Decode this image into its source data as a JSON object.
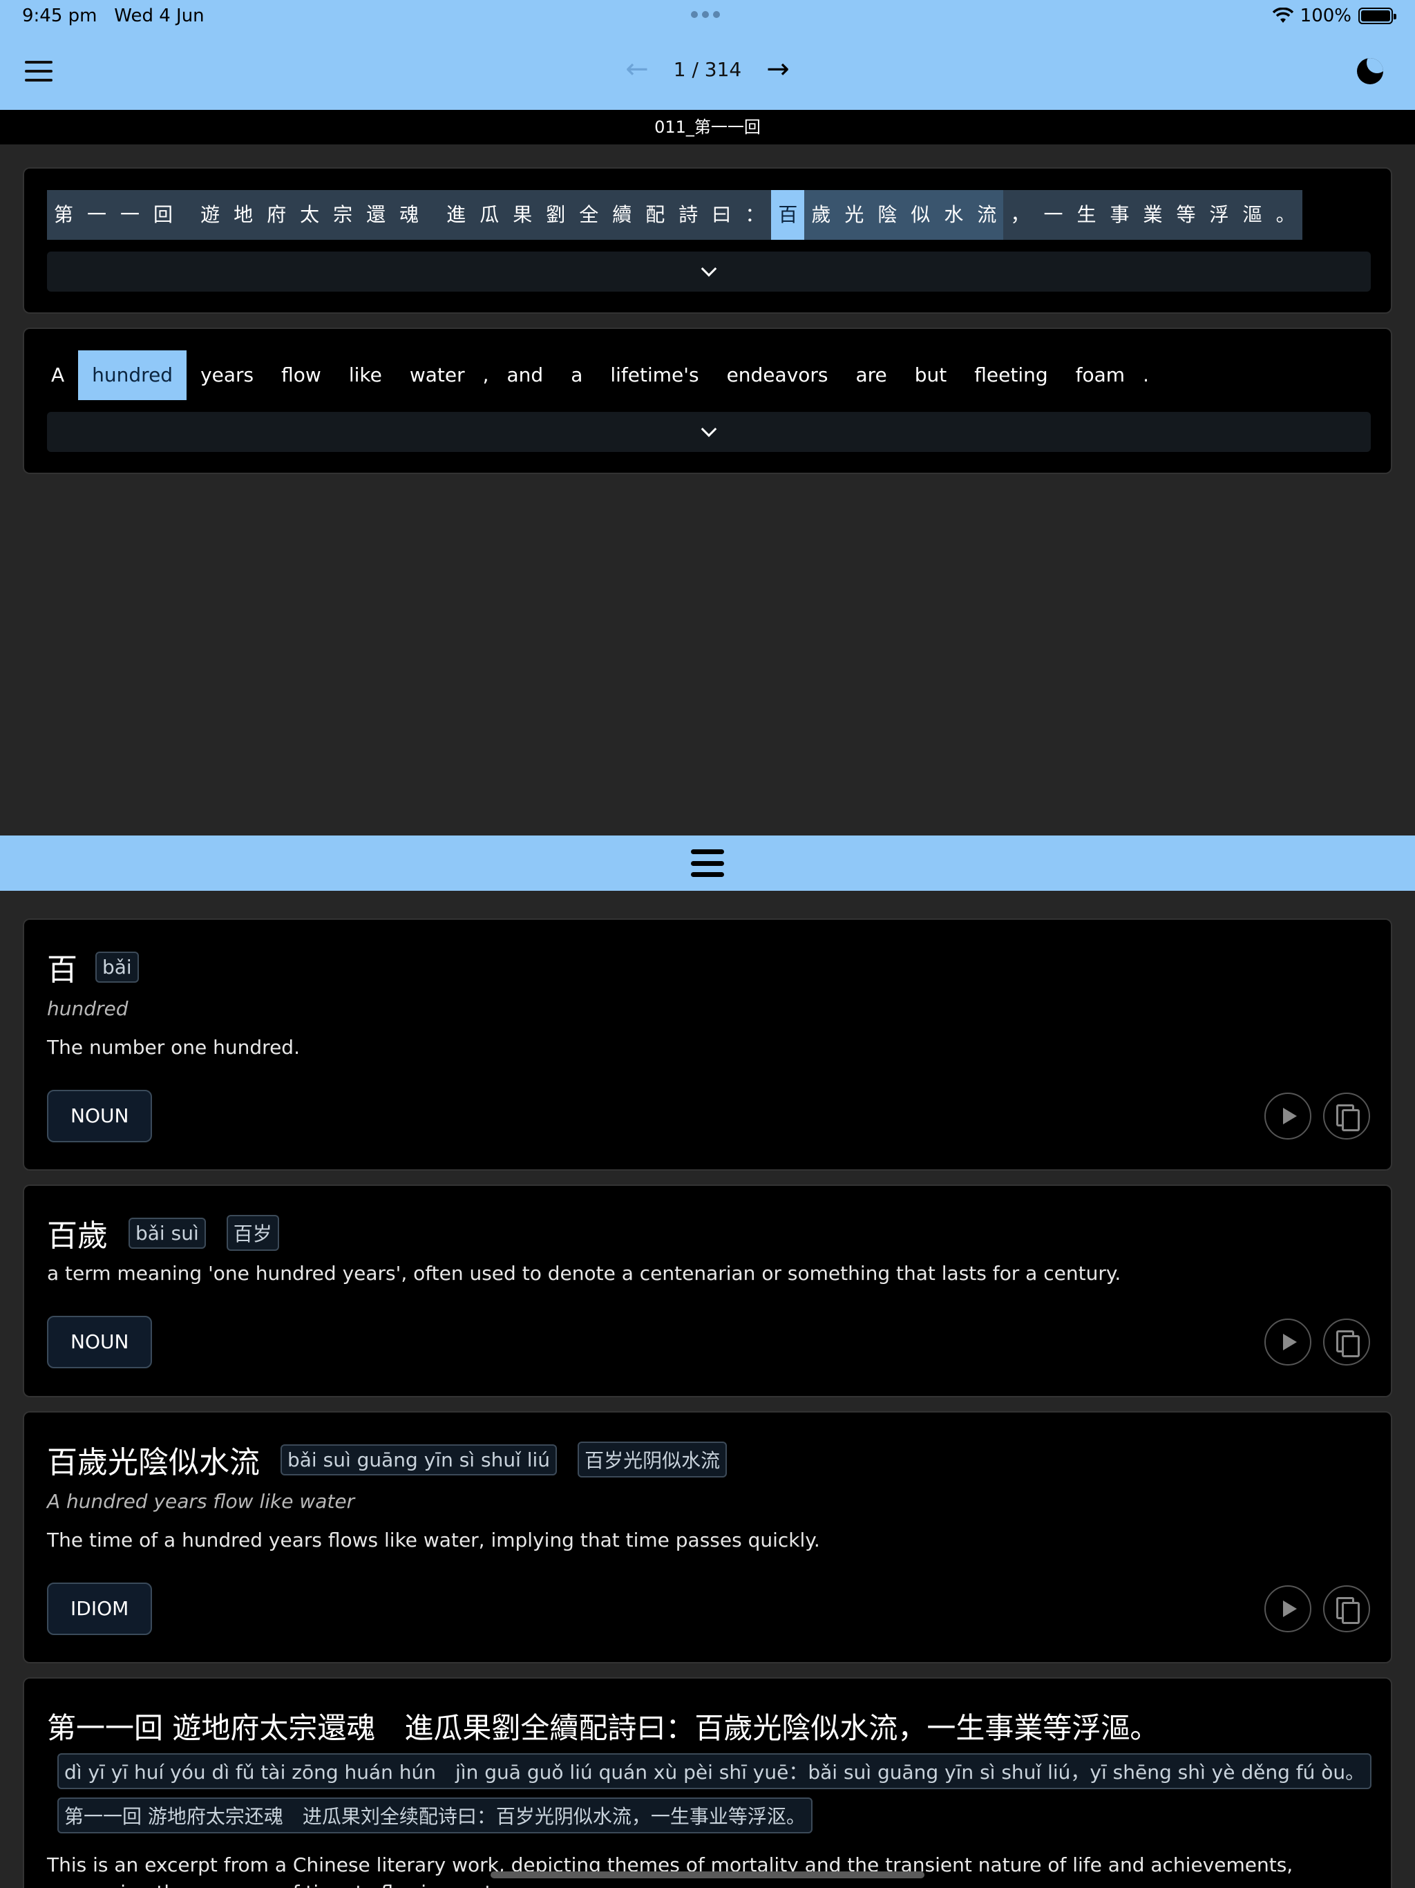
{
  "status": {
    "time": "9:45 pm",
    "date": "Wed 4 Jun",
    "battery": "100%",
    "battery_level": 1.0
  },
  "nav": {
    "page": "1 / 314",
    "prev_arrow": "←",
    "next_arrow": "→"
  },
  "chapter": "011_第一一回",
  "zh_sentence": {
    "tokens": [
      "第",
      "一",
      "一",
      "回",
      "遊",
      "地",
      "府",
      "太",
      "宗",
      "還",
      "魂",
      "進",
      "瓜",
      "果",
      "劉",
      "全",
      "續",
      "配",
      "詩",
      "曰",
      "：",
      "百",
      "歲",
      "光",
      "陰",
      "似",
      "水",
      "流",
      "，",
      "一",
      "生",
      "事",
      "業",
      "等",
      "浮",
      "漚",
      "。"
    ]
  },
  "en_sentence": {
    "tokens": [
      "A",
      "hundred",
      "years",
      "flow",
      "like",
      "water",
      ",",
      "and",
      "a",
      "lifetime's",
      "endeavors",
      "are",
      "but",
      "fleeting",
      "foam",
      "."
    ]
  },
  "entries": [
    {
      "word": "百",
      "pinyin": "bǎi",
      "gloss": "hundred",
      "definition": "The number one hundred.",
      "pos": "NOUN"
    },
    {
      "word": "百歲",
      "pinyin": "bǎi suì",
      "simplified": "百岁",
      "definition": "a term meaning 'one hundred years', often used to denote a centenarian or something that lasts for a century.",
      "pos": "NOUN"
    },
    {
      "word": "百歲光陰似水流",
      "pinyin": "bǎi suì guāng yīn sì shuǐ liú",
      "simplified": "百岁光阴似水流",
      "gloss": "A hundred years flow like water",
      "definition": "The time of a hundred years flows like water, implying that time passes quickly.",
      "pos": "IDIOM"
    }
  ],
  "full_sentence": {
    "text": "第一一回 遊地府太宗還魂　進瓜果劉全續配詩曰：百歲光陰似水流，一生事業等浮漚。",
    "pinyin": "dì yī yī huí yóu dì fǔ tài zōng huán hún　jìn guā guǒ liú quán xù pèi shī yuē：bǎi suì guāng yīn sì shuǐ liú，yī shēng shì yè děng fú òu。",
    "simplified": "第一一回 游地府太宗还魂　进瓜果刘全续配诗曰：百岁光阴似水流，一生事业等浮沤。",
    "definition": "This is an excerpt from a Chinese literary work, depicting themes of mortality and the transient nature of life and achievements, comparing the passage of time to flowing water."
  }
}
